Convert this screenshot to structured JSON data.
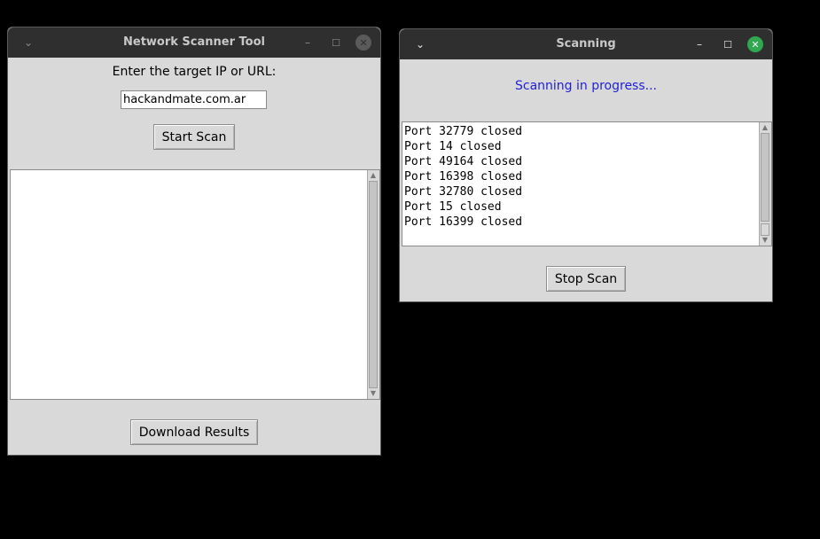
{
  "scanner_window": {
    "title": "Network Scanner Tool",
    "prompt_label": "Enter the target IP or URL:",
    "target_value": "hackandmate.com.ar",
    "start_button": "Start Scan",
    "download_button": "Download Results",
    "menu_glyph": "⌄",
    "minimize_glyph": "–",
    "maximize_glyph": "☐",
    "close_glyph": "✕"
  },
  "scanning_window": {
    "title": "Scanning",
    "status_text": "Scanning in progress...",
    "status_color": "#1f1fd6",
    "log_lines": [
      "Port 32779 closed",
      "Port 14 closed",
      "Port 49164 closed",
      "Port 16398 closed",
      "Port 32780 closed",
      "Port 15 closed",
      "Port 16399 closed"
    ],
    "stop_button": "Stop Scan",
    "menu_glyph": "⌄",
    "minimize_glyph": "–",
    "maximize_glyph": "☐",
    "close_glyph": "✕",
    "close_color": "#2fa84f"
  }
}
